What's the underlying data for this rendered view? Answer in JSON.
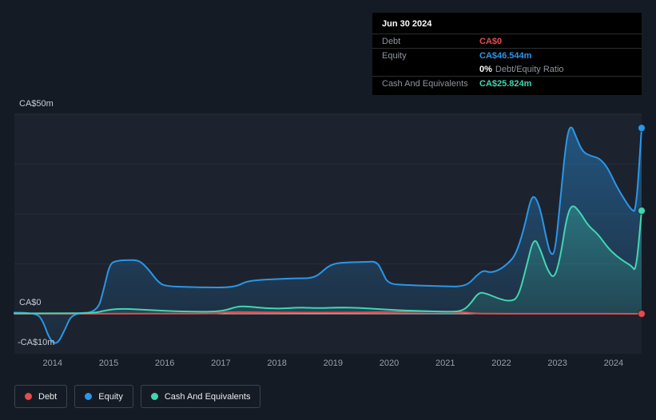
{
  "colors": {
    "debt": "#e64c4c",
    "equity": "#2b96e8",
    "cash": "#41d6b2",
    "grid": "#242e3b",
    "zero_line": "#c6cbd2"
  },
  "tooltip": {
    "date": "Jun 30 2024",
    "debt_label": "Debt",
    "debt_value": "CA$0",
    "equity_label": "Equity",
    "equity_value": "CA$46.544m",
    "ratio_value": "0%",
    "ratio_label": "Debt/Equity Ratio",
    "cash_label": "Cash And Equivalents",
    "cash_value": "CA$25.824m"
  },
  "legend": {
    "items": [
      {
        "label": "Debt",
        "key": "debt"
      },
      {
        "label": "Equity",
        "key": "equity"
      },
      {
        "label": "Cash And Equivalents",
        "key": "cash"
      }
    ]
  },
  "chart_data": {
    "type": "area",
    "unit": "CA$ millions",
    "x_range": [
      2013.32,
      2024.5
    ],
    "y_range": [
      -10,
      50
    ],
    "grid": true,
    "legend_position": "bottom",
    "grid_values": [
      50,
      37.5,
      25,
      12.5
    ],
    "x_ticks": [
      2014,
      2015,
      2016,
      2017,
      2018,
      2019,
      2020,
      2021,
      2022,
      2023,
      2024
    ],
    "y_axis_labels": [
      "CA$50m",
      "CA$0",
      "-CA$10m"
    ],
    "series": [
      {
        "key": "debt",
        "name": "Debt",
        "points": [
          [
            2013.32,
            0.02
          ],
          [
            2015.0,
            0.02
          ],
          [
            2016.5,
            0.05
          ],
          [
            2016.95,
            0.1
          ],
          [
            2017.15,
            0.45
          ],
          [
            2017.5,
            0.4
          ],
          [
            2018.0,
            0.35
          ],
          [
            2018.5,
            0.3
          ],
          [
            2019.0,
            0.3
          ],
          [
            2019.5,
            0.35
          ],
          [
            2020.0,
            0.45
          ],
          [
            2020.5,
            0.55
          ],
          [
            2020.9,
            0.6
          ],
          [
            2021.2,
            0.5
          ],
          [
            2021.45,
            0.2
          ],
          [
            2021.6,
            0.05
          ],
          [
            2022.0,
            0.02
          ],
          [
            2023.0,
            0.02
          ],
          [
            2024.5,
            0
          ]
        ]
      },
      {
        "key": "equity",
        "name": "Equity",
        "points": [
          [
            2013.32,
            0.3
          ],
          [
            2013.7,
            0.3
          ],
          [
            2013.82,
            -1.5
          ],
          [
            2013.95,
            -6.5
          ],
          [
            2014.08,
            -7.8
          ],
          [
            2014.22,
            -4.0
          ],
          [
            2014.35,
            0.2
          ],
          [
            2014.8,
            0.3
          ],
          [
            2014.92,
            6.5
          ],
          [
            2015.02,
            12.6
          ],
          [
            2015.15,
            13.3
          ],
          [
            2015.35,
            13.5
          ],
          [
            2015.55,
            13.4
          ],
          [
            2015.72,
            11.0
          ],
          [
            2015.9,
            7.6
          ],
          [
            2016.05,
            6.9
          ],
          [
            2016.4,
            6.7
          ],
          [
            2016.8,
            6.6
          ],
          [
            2017.1,
            6.6
          ],
          [
            2017.3,
            7.0
          ],
          [
            2017.45,
            8.1
          ],
          [
            2017.7,
            8.5
          ],
          [
            2018.0,
            8.7
          ],
          [
            2018.35,
            8.9
          ],
          [
            2018.6,
            8.9
          ],
          [
            2018.75,
            9.8
          ],
          [
            2018.9,
            11.8
          ],
          [
            2019.05,
            12.7
          ],
          [
            2019.3,
            12.9
          ],
          [
            2019.6,
            13.0
          ],
          [
            2019.78,
            13.1
          ],
          [
            2019.88,
            10.5
          ],
          [
            2019.98,
            7.5
          ],
          [
            2020.3,
            7.2
          ],
          [
            2020.7,
            7.0
          ],
          [
            2021.0,
            6.9
          ],
          [
            2021.25,
            6.8
          ],
          [
            2021.42,
            7.5
          ],
          [
            2021.55,
            9.5
          ],
          [
            2021.68,
            10.9
          ],
          [
            2021.8,
            10.3
          ],
          [
            2021.95,
            10.9
          ],
          [
            2022.1,
            12.4
          ],
          [
            2022.25,
            14.6
          ],
          [
            2022.4,
            21.0
          ],
          [
            2022.52,
            28.8
          ],
          [
            2022.6,
            29.6
          ],
          [
            2022.7,
            26.0
          ],
          [
            2022.8,
            19.0
          ],
          [
            2022.88,
            14.6
          ],
          [
            2022.96,
            15.5
          ],
          [
            2023.06,
            30.0
          ],
          [
            2023.16,
            44.0
          ],
          [
            2023.24,
            47.6
          ],
          [
            2023.34,
            44.0
          ],
          [
            2023.45,
            40.5
          ],
          [
            2023.6,
            39.5
          ],
          [
            2023.75,
            39.0
          ],
          [
            2023.9,
            36.5
          ],
          [
            2024.05,
            32.0
          ],
          [
            2024.2,
            28.5
          ],
          [
            2024.32,
            26.0
          ],
          [
            2024.4,
            25.5
          ],
          [
            2024.5,
            46.544
          ]
        ]
      },
      {
        "key": "cash",
        "name": "Cash And Equivalents",
        "points": [
          [
            2013.32,
            0.1
          ],
          [
            2014.2,
            0.1
          ],
          [
            2014.75,
            0.2
          ],
          [
            2014.95,
            0.9
          ],
          [
            2015.2,
            1.3
          ],
          [
            2015.55,
            1.1
          ],
          [
            2015.9,
            0.8
          ],
          [
            2016.3,
            0.6
          ],
          [
            2016.75,
            0.5
          ],
          [
            2017.05,
            0.7
          ],
          [
            2017.3,
            1.9
          ],
          [
            2017.5,
            1.8
          ],
          [
            2017.8,
            1.4
          ],
          [
            2018.1,
            1.3
          ],
          [
            2018.4,
            1.6
          ],
          [
            2018.75,
            1.4
          ],
          [
            2019.1,
            1.6
          ],
          [
            2019.45,
            1.5
          ],
          [
            2019.8,
            1.2
          ],
          [
            2020.15,
            0.9
          ],
          [
            2020.6,
            0.7
          ],
          [
            2021.0,
            0.5
          ],
          [
            2021.3,
            0.6
          ],
          [
            2021.45,
            2.5
          ],
          [
            2021.6,
            5.5
          ],
          [
            2021.75,
            5.0
          ],
          [
            2021.95,
            3.8
          ],
          [
            2022.15,
            3.1
          ],
          [
            2022.3,
            4.0
          ],
          [
            2022.45,
            12.0
          ],
          [
            2022.58,
            19.4
          ],
          [
            2022.7,
            16.0
          ],
          [
            2022.82,
            11.0
          ],
          [
            2022.94,
            8.6
          ],
          [
            2023.05,
            14.0
          ],
          [
            2023.16,
            24.0
          ],
          [
            2023.26,
            27.6
          ],
          [
            2023.4,
            25.5
          ],
          [
            2023.55,
            22.0
          ],
          [
            2023.72,
            20.0
          ],
          [
            2023.9,
            16.5
          ],
          [
            2024.05,
            14.5
          ],
          [
            2024.2,
            13.0
          ],
          [
            2024.32,
            12.0
          ],
          [
            2024.4,
            10.5
          ],
          [
            2024.5,
            25.824
          ]
        ]
      }
    ]
  }
}
